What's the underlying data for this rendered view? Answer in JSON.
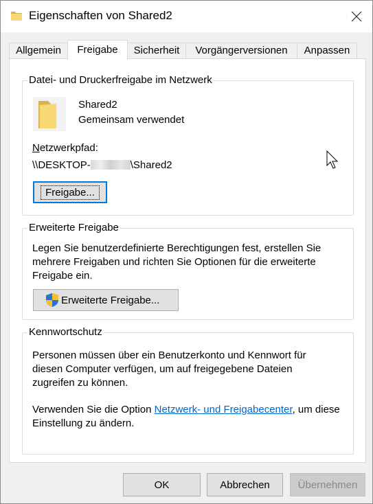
{
  "window": {
    "title": "Eigenschaften von Shared2",
    "icon": "folder-icon"
  },
  "tabs": [
    {
      "label": "Allgemein",
      "active": false
    },
    {
      "label": "Freigabe",
      "active": true
    },
    {
      "label": "Sicherheit",
      "active": false
    },
    {
      "label": "Vorgängerversionen",
      "active": false
    },
    {
      "label": "Anpassen",
      "active": false
    }
  ],
  "network_sharing": {
    "group_title": "Datei- und Druckerfreigabe im Netzwerk",
    "folder_name": "Shared2",
    "status": "Gemeinsam verwendet",
    "path_label": "Netzwerkpfad:",
    "path_prefix": "\\\\DESKTOP-",
    "path_suffix": "\\Shared2",
    "share_button": "Freigabe..."
  },
  "advanced_sharing": {
    "group_title": "Erweiterte Freigabe",
    "description": "Legen Sie benutzerdefinierte Berechtigungen fest, erstellen Sie mehrere Freigaben und richten Sie Optionen für die erweiterte Freigabe ein.",
    "button": "Erweiterte Freigabe..."
  },
  "password_protection": {
    "group_title": "Kennwortschutz",
    "description": "Personen müssen über ein Benutzerkonto und Kennwort für diesen Computer verfügen, um auf freigegebene Dateien zugreifen zu können.",
    "option_prefix": "Verwenden Sie die Option ",
    "option_link": "Netzwerk- und Freigabecenter",
    "option_suffix": ", um diese Einstellung zu ändern."
  },
  "buttons": {
    "ok": "OK",
    "cancel": "Abbrechen",
    "apply": "Übernehmen"
  },
  "colors": {
    "accent": "#0078d7",
    "link": "#0066cc",
    "folder": "#f8d775"
  }
}
